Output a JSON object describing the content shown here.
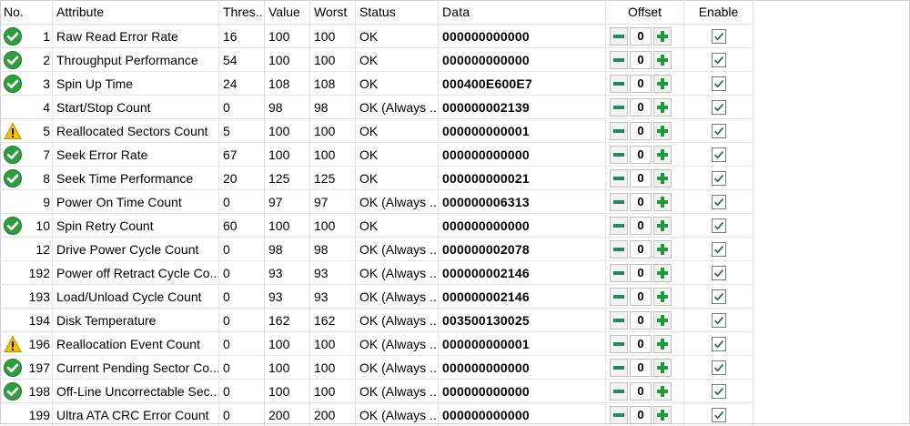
{
  "headers": {
    "no": "No.",
    "attribute": "Attribute",
    "threshold": "Thres...",
    "value": "Value",
    "worst": "Worst",
    "status": "Status",
    "data": "Data",
    "offset": "Offset",
    "enable": "Enable"
  },
  "colors": {
    "ok": "#2e9e3e",
    "warning": "#f2c400",
    "plus": "#1f9a3a",
    "minus": "#2a8a5a"
  },
  "rows": [
    {
      "icon": "ok",
      "no": "1",
      "attribute": "Raw Read Error Rate",
      "threshold": "16",
      "value": "100",
      "worst": "100",
      "status": "OK",
      "data": "000000000000",
      "offset": "0",
      "enabled": true
    },
    {
      "icon": "ok",
      "no": "2",
      "attribute": "Throughput Performance",
      "threshold": "54",
      "value": "100",
      "worst": "100",
      "status": "OK",
      "data": "000000000000",
      "offset": "0",
      "enabled": true
    },
    {
      "icon": "ok",
      "no": "3",
      "attribute": "Spin Up Time",
      "threshold": "24",
      "value": "108",
      "worst": "108",
      "status": "OK",
      "data": "000400E600E7",
      "offset": "0",
      "enabled": true
    },
    {
      "icon": "none",
      "no": "4",
      "attribute": "Start/Stop Count",
      "threshold": "0",
      "value": "98",
      "worst": "98",
      "status": "OK (Always ...",
      "data": "000000002139",
      "offset": "0",
      "enabled": true
    },
    {
      "icon": "warning",
      "no": "5",
      "attribute": "Reallocated Sectors Count",
      "threshold": "5",
      "value": "100",
      "worst": "100",
      "status": "OK",
      "data": "000000000001",
      "offset": "0",
      "enabled": true
    },
    {
      "icon": "ok",
      "no": "7",
      "attribute": "Seek Error Rate",
      "threshold": "67",
      "value": "100",
      "worst": "100",
      "status": "OK",
      "data": "000000000000",
      "offset": "0",
      "enabled": true
    },
    {
      "icon": "ok",
      "no": "8",
      "attribute": "Seek Time Performance",
      "threshold": "20",
      "value": "125",
      "worst": "125",
      "status": "OK",
      "data": "000000000021",
      "offset": "0",
      "enabled": true
    },
    {
      "icon": "none",
      "no": "9",
      "attribute": "Power On Time Count",
      "threshold": "0",
      "value": "97",
      "worst": "97",
      "status": "OK (Always ...",
      "data": "000000006313",
      "offset": "0",
      "enabled": true
    },
    {
      "icon": "ok",
      "no": "10",
      "attribute": "Spin Retry Count",
      "threshold": "60",
      "value": "100",
      "worst": "100",
      "status": "OK",
      "data": "000000000000",
      "offset": "0",
      "enabled": true
    },
    {
      "icon": "none",
      "no": "12",
      "attribute": "Drive Power Cycle Count",
      "threshold": "0",
      "value": "98",
      "worst": "98",
      "status": "OK (Always ...",
      "data": "000000002078",
      "offset": "0",
      "enabled": true
    },
    {
      "icon": "none",
      "no": "192",
      "attribute": "Power off Retract Cycle Co...",
      "threshold": "0",
      "value": "93",
      "worst": "93",
      "status": "OK (Always ...",
      "data": "000000002146",
      "offset": "0",
      "enabled": true
    },
    {
      "icon": "none",
      "no": "193",
      "attribute": "Load/Unload Cycle Count",
      "threshold": "0",
      "value": "93",
      "worst": "93",
      "status": "OK (Always ...",
      "data": "000000002146",
      "offset": "0",
      "enabled": true
    },
    {
      "icon": "none",
      "no": "194",
      "attribute": "Disk Temperature",
      "threshold": "0",
      "value": "162",
      "worst": "162",
      "status": "OK (Always ...",
      "data": "003500130025",
      "offset": "0",
      "enabled": true
    },
    {
      "icon": "warning",
      "no": "196",
      "attribute": "Reallocation Event Count",
      "threshold": "0",
      "value": "100",
      "worst": "100",
      "status": "OK (Always ...",
      "data": "000000000001",
      "offset": "0",
      "enabled": true
    },
    {
      "icon": "ok",
      "no": "197",
      "attribute": "Current Pending Sector Co...",
      "threshold": "0",
      "value": "100",
      "worst": "100",
      "status": "OK (Always ...",
      "data": "000000000000",
      "offset": "0",
      "enabled": true
    },
    {
      "icon": "ok",
      "no": "198",
      "attribute": "Off-Line Uncorrectable Sec...",
      "threshold": "0",
      "value": "100",
      "worst": "100",
      "status": "OK (Always ...",
      "data": "000000000000",
      "offset": "0",
      "enabled": true
    },
    {
      "icon": "none",
      "no": "199",
      "attribute": "Ultra ATA CRC Error Count",
      "threshold": "0",
      "value": "200",
      "worst": "200",
      "status": "OK (Always ...",
      "data": "000000000000",
      "offset": "0",
      "enabled": true
    }
  ]
}
